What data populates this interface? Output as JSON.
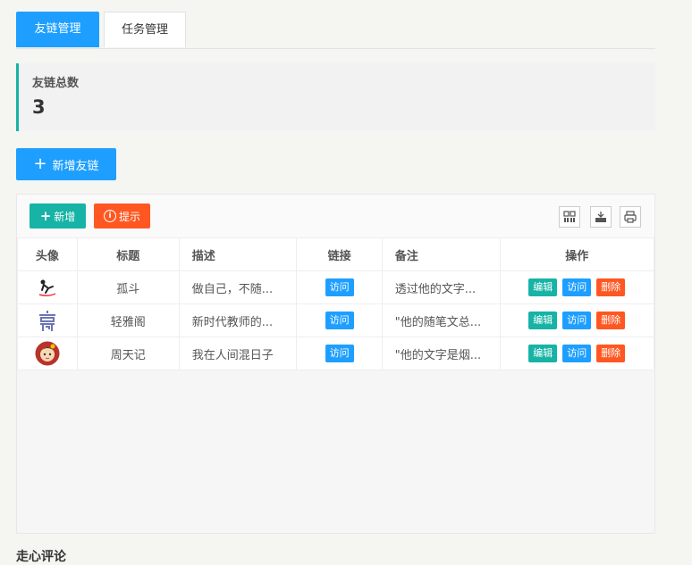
{
  "tabs": [
    {
      "label": "友链管理",
      "active": true
    },
    {
      "label": "任务管理",
      "active": false
    }
  ],
  "stat": {
    "label": "友链总数",
    "value": "3"
  },
  "add_friend_button": "新增友链",
  "toolbar": {
    "add_label": "新增",
    "tip_label": "提示"
  },
  "table": {
    "headers": [
      "头像",
      "标题",
      "描述",
      "链接",
      "备注",
      "操作"
    ],
    "rows": [
      {
        "avatar": "skater-logo",
        "title": "孤斗",
        "desc": "做自己，不随...",
        "link": "访问",
        "note": "透过他的文字...",
        "edit": "编辑",
        "visit": "访问",
        "delete": "删除"
      },
      {
        "avatar": "pavilion-logo",
        "title": "轻雅阁",
        "desc": "新时代教师的...",
        "link": "访问",
        "note": "\"他的随笔文总...",
        "edit": "编辑",
        "visit": "访问",
        "delete": "删除"
      },
      {
        "avatar": "girl-avatar",
        "title": "周天记",
        "desc": "我在人间混日子",
        "link": "访问",
        "note": "\"他的文字是烟...",
        "edit": "编辑",
        "visit": "访问",
        "delete": "删除"
      }
    ]
  },
  "bottom_section_title": "走心评论",
  "colors": {
    "primary": "#1e9fff",
    "green": "#16b3a6",
    "orange": "#ff5722"
  }
}
